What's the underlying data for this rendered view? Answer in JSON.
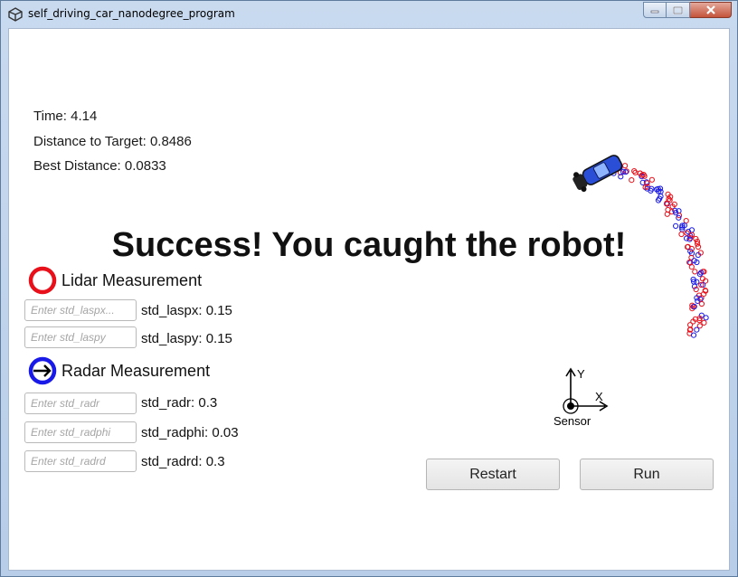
{
  "window": {
    "title": "self_driving_car_nanodegree_program"
  },
  "stats": {
    "time": "Time: 4.14",
    "distance_to_target": "Distance to Target: 0.8486",
    "best_distance": "Best Distance: 0.0833"
  },
  "message": "Success! You caught the robot!",
  "lidar": {
    "label": "Lidar Measurement",
    "color": "#e8101a",
    "fields": [
      {
        "placeholder": "Enter std_laspx...",
        "value_text": "std_laspx: 0.15"
      },
      {
        "placeholder": "Enter std_laspy",
        "value_text": "std_laspy: 0.15"
      }
    ]
  },
  "radar": {
    "label": "Radar Measurement",
    "color": "#1a1ae8",
    "fields": [
      {
        "placeholder": "Enter std_radr",
        "value_text": "std_radr: 0.3"
      },
      {
        "placeholder": "Enter std_radphi",
        "value_text": "std_radphi: 0.03"
      },
      {
        "placeholder": "Enter std_radrd",
        "value_text": "std_radrd: 0.3"
      }
    ]
  },
  "axes": {
    "y_label": "Y",
    "x_label": "X",
    "sensor_label": "Sensor"
  },
  "buttons": {
    "restart": "Restart",
    "run": "Run"
  }
}
